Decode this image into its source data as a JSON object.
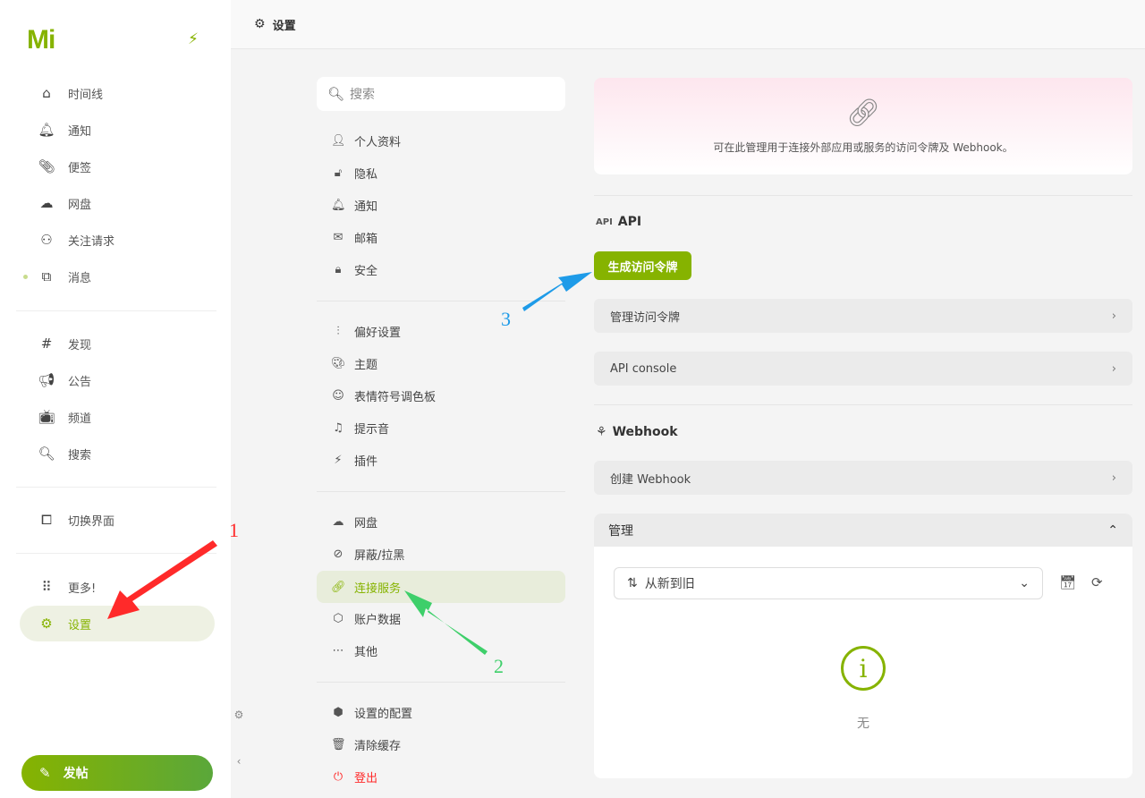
{
  "nav": {
    "logo": "Mi",
    "items": [
      {
        "label": "时间线",
        "icon": "home-icon"
      },
      {
        "label": "通知",
        "icon": "bell-icon"
      },
      {
        "label": "便签",
        "icon": "paperclip-icon"
      },
      {
        "label": "网盘",
        "icon": "cloud-icon"
      },
      {
        "label": "关注请求",
        "icon": "user-plus-icon"
      },
      {
        "label": "消息",
        "icon": "messages-icon"
      },
      {
        "label": "发现",
        "icon": "hash-icon"
      },
      {
        "label": "公告",
        "icon": "megaphone-icon"
      },
      {
        "label": "频道",
        "icon": "tv-icon"
      },
      {
        "label": "搜索",
        "icon": "search-icon"
      },
      {
        "label": "切换界面",
        "icon": "devices-icon"
      },
      {
        "label": "更多!",
        "icon": "grid-dots-icon"
      },
      {
        "label": "设置",
        "icon": "settings-icon"
      }
    ],
    "post_label": "发帖"
  },
  "header": {
    "title": "设置"
  },
  "search": {
    "placeholder": "搜索"
  },
  "menu": {
    "group1": [
      "个人资料",
      "隐私",
      "通知",
      "邮箱",
      "安全"
    ],
    "group2": [
      "偏好设置",
      "主题",
      "表情符号调色板",
      "提示音",
      "插件"
    ],
    "group3": [
      "网盘",
      "屏蔽/拉黑",
      "连接服务",
      "账户数据",
      "其他"
    ],
    "group4": [
      "设置的配置",
      "清除缓存",
      "登出"
    ]
  },
  "panel": {
    "banner_text": "可在此管理用于连接外部应用或服务的访问令牌及 Webhook。",
    "api_icon_text": "API",
    "api_title": "API",
    "generate_token": "生成访问令牌",
    "manage_tokens": "管理访问令牌",
    "api_console": "API console",
    "webhook_title": "Webhook",
    "create_webhook": "创建 Webhook",
    "manage_title": "管理",
    "sort_label": "从新到旧",
    "empty_text": "无"
  },
  "annotations": {
    "a1": "1",
    "a2": "2",
    "a3": "3"
  },
  "colors": {
    "accent": "#86b300",
    "red_arrow": "#ff2a2a",
    "green_arrow": "#3ecf6a",
    "blue_arrow": "#1e9be8"
  }
}
